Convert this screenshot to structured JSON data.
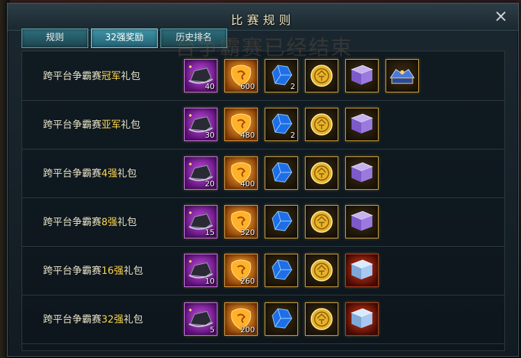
{
  "window": {
    "title": "比赛规则",
    "close_glyph": "×"
  },
  "tabs": [
    {
      "label": "规则",
      "active": false
    },
    {
      "label": "32强奖励",
      "active": true
    },
    {
      "label": "历史排名",
      "active": false
    }
  ],
  "watermark": "台争霸赛已经结束",
  "label_prefix": "跨平台争霸赛",
  "label_suffix": "礼包",
  "rewards": [
    {
      "rank": "冠军",
      "items": [
        {
          "icon": "purple-hat-icon",
          "qty": "40"
        },
        {
          "icon": "orange-stone-icon",
          "qty": "600"
        },
        {
          "icon": "blue-gem-icon",
          "qty": "2"
        },
        {
          "icon": "gold-coin-icon",
          "qty": ""
        },
        {
          "icon": "purple-book-icon",
          "qty": ""
        },
        {
          "icon": "champion-title-icon",
          "qty": ""
        }
      ]
    },
    {
      "rank": "亚军",
      "items": [
        {
          "icon": "purple-hat-icon",
          "qty": "30"
        },
        {
          "icon": "orange-stone-icon",
          "qty": "480"
        },
        {
          "icon": "blue-gem-icon",
          "qty": "2"
        },
        {
          "icon": "gold-coin-icon",
          "qty": ""
        },
        {
          "icon": "purple-book-icon",
          "qty": ""
        }
      ]
    },
    {
      "rank": "4强",
      "items": [
        {
          "icon": "purple-hat-icon",
          "qty": "20"
        },
        {
          "icon": "orange-stone-icon",
          "qty": "400"
        },
        {
          "icon": "blue-gem-icon",
          "qty": ""
        },
        {
          "icon": "gold-coin-icon",
          "qty": ""
        },
        {
          "icon": "purple-book-icon",
          "qty": ""
        }
      ]
    },
    {
      "rank": "8强",
      "items": [
        {
          "icon": "purple-hat-icon",
          "qty": "15"
        },
        {
          "icon": "orange-stone-icon",
          "qty": "320"
        },
        {
          "icon": "blue-gem-icon",
          "qty": ""
        },
        {
          "icon": "gold-coin-icon",
          "qty": ""
        },
        {
          "icon": "purple-book-icon",
          "qty": ""
        }
      ]
    },
    {
      "rank": "16强",
      "items": [
        {
          "icon": "purple-hat-icon",
          "qty": "10"
        },
        {
          "icon": "orange-stone-icon",
          "qty": "260"
        },
        {
          "icon": "blue-gem-icon",
          "qty": ""
        },
        {
          "icon": "gold-coin-icon",
          "qty": ""
        },
        {
          "icon": "blue-book-icon",
          "qty": ""
        }
      ]
    },
    {
      "rank": "32强",
      "items": [
        {
          "icon": "purple-hat-icon",
          "qty": "5"
        },
        {
          "icon": "orange-stone-icon",
          "qty": "200"
        },
        {
          "icon": "blue-gem-icon",
          "qty": ""
        },
        {
          "icon": "gold-coin-icon",
          "qty": ""
        },
        {
          "icon": "blue-book-icon",
          "qty": ""
        }
      ]
    }
  ],
  "colors": {
    "highlight": "#ffd64a",
    "label": "#e9e3c7",
    "title": "#f2e8c4"
  }
}
